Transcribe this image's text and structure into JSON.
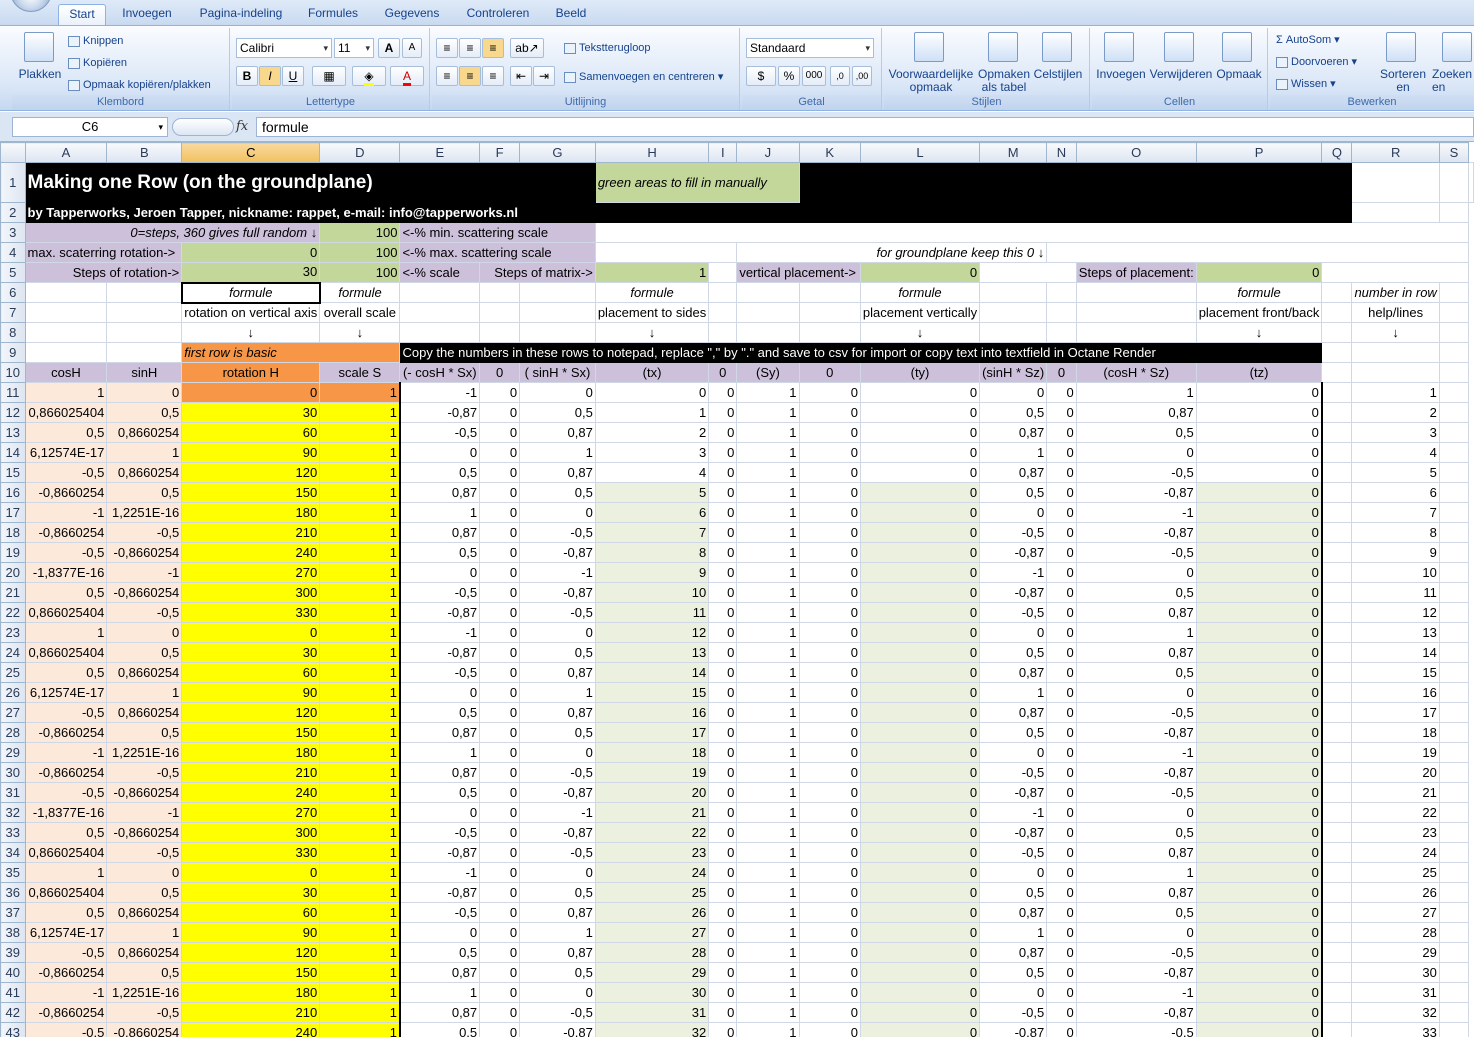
{
  "tabs": [
    "Start",
    "Invoegen",
    "Pagina-indeling",
    "Formules",
    "Gegevens",
    "Controleren",
    "Beeld"
  ],
  "ribbon": {
    "clipboard": {
      "paste": "Plakken",
      "cut": "Knippen",
      "copy": "Kopiëren",
      "format_painter": "Opmaak kopiëren/plakken",
      "label": "Klembord"
    },
    "font": {
      "name": "Calibri",
      "size": "11",
      "label": "Lettertype",
      "bold": "B",
      "italic": "I",
      "underline": "U",
      "grow": "A",
      "shrink": "A"
    },
    "alignment": {
      "wrap": "Tekstterugloop",
      "merge": "Samenvoegen en centreren",
      "label": "Uitlijning"
    },
    "number": {
      "format": "Standaard",
      "currency": "$",
      "percent": "%",
      "thousands": "000",
      "label": "Getal"
    },
    "styles": {
      "conditional": "Voorwaardelijke opmaak",
      "table": "Opmaken als tabel",
      "cell": "Celstijlen",
      "label": "Stijlen"
    },
    "cells": {
      "insert": "Invoegen",
      "delete": "Verwijderen",
      "format": "Opmaak",
      "label": "Cellen"
    },
    "editing": {
      "autosum": "AutoSom",
      "fill": "Doorvoeren",
      "clear": "Wissen",
      "sort": "Sorteren en filteren",
      "find": "Zoeken en selecteren",
      "label": "Bewerken"
    }
  },
  "formula_bar": {
    "name_box": "C6",
    "fx": "fx",
    "content": "formule"
  },
  "columns": [
    "A",
    "B",
    "C",
    "D",
    "E",
    "F",
    "G",
    "H",
    "I",
    "J",
    "K",
    "L",
    "M",
    "N",
    "O",
    "P",
    "Q",
    "R",
    "S"
  ],
  "header_rows": {
    "title": "Making one Row (on the groundplane)",
    "green_note": "green areas to fill in manually",
    "byline": "by Tapperworks, Jeroen Tapper, nickname: rappet, e-mail: info@tapperworks.nl",
    "r3a": "0=steps, 360 gives full random ↓",
    "r3d": "100",
    "r3e": "<-% min. scattering scale",
    "r4a": "max. scaterring rotation->",
    "r4c": "0",
    "r4d": "100",
    "r4e": "<-% max. scattering scale",
    "r4j": "for groundplane keep this 0 ↓",
    "r5a": "Steps of rotation->",
    "r5c": "30",
    "r5d": "100",
    "r5e": "<-% scale",
    "r5g": "Steps of matrix->",
    "r5h": "1",
    "r5j": "vertical placement->",
    "r5l": "0",
    "r5o": "Steps of placement:",
    "r5p": "0",
    "r6c": "formule",
    "r6d": "formule",
    "r6h": "formule",
    "r6l": "formule",
    "r6p": "formule",
    "r6r": "number in row",
    "r7c": "rotation on vertical axis",
    "r7d": "overall scale",
    "r7h": "placement to sides",
    "r7l": "placement vertically",
    "r7p": "placement front/back",
    "r7r": "help/lines",
    "arrow": "↓",
    "r9c": "first row is basic",
    "r9e": "Copy the numbers in these rows to notepad, replace \",\" by \".\" and save to csv for import or copy text into textfield in Octane Render",
    "r10": [
      "cosH",
      "sinH",
      "rotation H",
      "scale S",
      "(- cosH * Sx)",
      "0",
      "( sinH * Sx)",
      "(tx)",
      "0",
      "(Sy)",
      "0",
      "(ty)",
      "(sinH * Sz)",
      "0",
      "(cosH * Sz)",
      "(tz)"
    ]
  },
  "table_rows": [
    [
      "1",
      "0",
      "0",
      "1",
      "-1",
      "0",
      "0",
      "0",
      "0",
      "1",
      "0",
      "0",
      "0",
      "0",
      "1",
      "0",
      "1"
    ],
    [
      "0,866025404",
      "0,5",
      "30",
      "1",
      "-0,87",
      "0",
      "0,5",
      "1",
      "0",
      "1",
      "0",
      "0",
      "0,5",
      "0",
      "0,87",
      "0",
      "2"
    ],
    [
      "0,5",
      "0,8660254",
      "60",
      "1",
      "-0,5",
      "0",
      "0,87",
      "2",
      "0",
      "1",
      "0",
      "0",
      "0,87",
      "0",
      "0,5",
      "0",
      "3"
    ],
    [
      "6,12574E-17",
      "1",
      "90",
      "1",
      "0",
      "0",
      "1",
      "3",
      "0",
      "1",
      "0",
      "0",
      "1",
      "0",
      "0",
      "0",
      "4"
    ],
    [
      "-0,5",
      "0,8660254",
      "120",
      "1",
      "0,5",
      "0",
      "0,87",
      "4",
      "0",
      "1",
      "0",
      "0",
      "0,87",
      "0",
      "-0,5",
      "0",
      "5"
    ],
    [
      "-0,8660254",
      "0,5",
      "150",
      "1",
      "0,87",
      "0",
      "0,5",
      "5",
      "0",
      "1",
      "0",
      "0",
      "0,5",
      "0",
      "-0,87",
      "0",
      "6"
    ],
    [
      "-1",
      "1,2251E-16",
      "180",
      "1",
      "1",
      "0",
      "0",
      "6",
      "0",
      "1",
      "0",
      "0",
      "0",
      "0",
      "-1",
      "0",
      "7"
    ],
    [
      "-0,8660254",
      "-0,5",
      "210",
      "1",
      "0,87",
      "0",
      "-0,5",
      "7",
      "0",
      "1",
      "0",
      "0",
      "-0,5",
      "0",
      "-0,87",
      "0",
      "8"
    ],
    [
      "-0,5",
      "-0,8660254",
      "240",
      "1",
      "0,5",
      "0",
      "-0,87",
      "8",
      "0",
      "1",
      "0",
      "0",
      "-0,87",
      "0",
      "-0,5",
      "0",
      "9"
    ],
    [
      "-1,8377E-16",
      "-1",
      "270",
      "1",
      "0",
      "0",
      "-1",
      "9",
      "0",
      "1",
      "0",
      "0",
      "-1",
      "0",
      "0",
      "0",
      "10"
    ],
    [
      "0,5",
      "-0,8660254",
      "300",
      "1",
      "-0,5",
      "0",
      "-0,87",
      "10",
      "0",
      "1",
      "0",
      "0",
      "-0,87",
      "0",
      "0,5",
      "0",
      "11"
    ],
    [
      "0,866025404",
      "-0,5",
      "330",
      "1",
      "-0,87",
      "0",
      "-0,5",
      "11",
      "0",
      "1",
      "0",
      "0",
      "-0,5",
      "0",
      "0,87",
      "0",
      "12"
    ],
    [
      "1",
      "0",
      "0",
      "1",
      "-1",
      "0",
      "0",
      "12",
      "0",
      "1",
      "0",
      "0",
      "0",
      "0",
      "1",
      "0",
      "13"
    ],
    [
      "0,866025404",
      "0,5",
      "30",
      "1",
      "-0,87",
      "0",
      "0,5",
      "13",
      "0",
      "1",
      "0",
      "0",
      "0,5",
      "0",
      "0,87",
      "0",
      "14"
    ],
    [
      "0,5",
      "0,8660254",
      "60",
      "1",
      "-0,5",
      "0",
      "0,87",
      "14",
      "0",
      "1",
      "0",
      "0",
      "0,87",
      "0",
      "0,5",
      "0",
      "15"
    ],
    [
      "6,12574E-17",
      "1",
      "90",
      "1",
      "0",
      "0",
      "1",
      "15",
      "0",
      "1",
      "0",
      "0",
      "1",
      "0",
      "0",
      "0",
      "16"
    ],
    [
      "-0,5",
      "0,8660254",
      "120",
      "1",
      "0,5",
      "0",
      "0,87",
      "16",
      "0",
      "1",
      "0",
      "0",
      "0,87",
      "0",
      "-0,5",
      "0",
      "17"
    ],
    [
      "-0,8660254",
      "0,5",
      "150",
      "1",
      "0,87",
      "0",
      "0,5",
      "17",
      "0",
      "1",
      "0",
      "0",
      "0,5",
      "0",
      "-0,87",
      "0",
      "18"
    ],
    [
      "-1",
      "1,2251E-16",
      "180",
      "1",
      "1",
      "0",
      "0",
      "18",
      "0",
      "1",
      "0",
      "0",
      "0",
      "0",
      "-1",
      "0",
      "19"
    ],
    [
      "-0,8660254",
      "-0,5",
      "210",
      "1",
      "0,87",
      "0",
      "-0,5",
      "19",
      "0",
      "1",
      "0",
      "0",
      "-0,5",
      "0",
      "-0,87",
      "0",
      "20"
    ],
    [
      "-0,5",
      "-0,8660254",
      "240",
      "1",
      "0,5",
      "0",
      "-0,87",
      "20",
      "0",
      "1",
      "0",
      "0",
      "-0,87",
      "0",
      "-0,5",
      "0",
      "21"
    ],
    [
      "-1,8377E-16",
      "-1",
      "270",
      "1",
      "0",
      "0",
      "-1",
      "21",
      "0",
      "1",
      "0",
      "0",
      "-1",
      "0",
      "0",
      "0",
      "22"
    ],
    [
      "0,5",
      "-0,8660254",
      "300",
      "1",
      "-0,5",
      "0",
      "-0,87",
      "22",
      "0",
      "1",
      "0",
      "0",
      "-0,87",
      "0",
      "0,5",
      "0",
      "23"
    ],
    [
      "0,866025404",
      "-0,5",
      "330",
      "1",
      "-0,87",
      "0",
      "-0,5",
      "23",
      "0",
      "1",
      "0",
      "0",
      "-0,5",
      "0",
      "0,87",
      "0",
      "24"
    ],
    [
      "1",
      "0",
      "0",
      "1",
      "-1",
      "0",
      "0",
      "24",
      "0",
      "1",
      "0",
      "0",
      "0",
      "0",
      "1",
      "0",
      "25"
    ],
    [
      "0,866025404",
      "0,5",
      "30",
      "1",
      "-0,87",
      "0",
      "0,5",
      "25",
      "0",
      "1",
      "0",
      "0",
      "0,5",
      "0",
      "0,87",
      "0",
      "26"
    ],
    [
      "0,5",
      "0,8660254",
      "60",
      "1",
      "-0,5",
      "0",
      "0,87",
      "26",
      "0",
      "1",
      "0",
      "0",
      "0,87",
      "0",
      "0,5",
      "0",
      "27"
    ],
    [
      "6,12574E-17",
      "1",
      "90",
      "1",
      "0",
      "0",
      "1",
      "27",
      "0",
      "1",
      "0",
      "0",
      "1",
      "0",
      "0",
      "0",
      "28"
    ],
    [
      "-0,5",
      "0,8660254",
      "120",
      "1",
      "0,5",
      "0",
      "0,87",
      "28",
      "0",
      "1",
      "0",
      "0",
      "0,87",
      "0",
      "-0,5",
      "0",
      "29"
    ],
    [
      "-0,8660254",
      "0,5",
      "150",
      "1",
      "0,87",
      "0",
      "0,5",
      "29",
      "0",
      "1",
      "0",
      "0",
      "0,5",
      "0",
      "-0,87",
      "0",
      "30"
    ],
    [
      "-1",
      "1,2251E-16",
      "180",
      "1",
      "1",
      "0",
      "0",
      "30",
      "0",
      "1",
      "0",
      "0",
      "0",
      "0",
      "-1",
      "0",
      "31"
    ],
    [
      "-0,8660254",
      "-0,5",
      "210",
      "1",
      "0,87",
      "0",
      "-0,5",
      "31",
      "0",
      "1",
      "0",
      "0",
      "-0,5",
      "0",
      "-0,87",
      "0",
      "32"
    ],
    [
      "-0,5",
      "-0,8660254",
      "240",
      "1",
      "0,5",
      "0",
      "-0,87",
      "32",
      "0",
      "1",
      "0",
      "0",
      "-0,87",
      "0",
      "-0,5",
      "0",
      "33"
    ]
  ],
  "colors": {
    "black": "#000000",
    "lavender": "#ccc0da",
    "green": "#c4d79b",
    "light_green": "#ebf1de",
    "peach": "#fde9d9",
    "orange": "#f79646",
    "yellow": "#ffff00"
  }
}
